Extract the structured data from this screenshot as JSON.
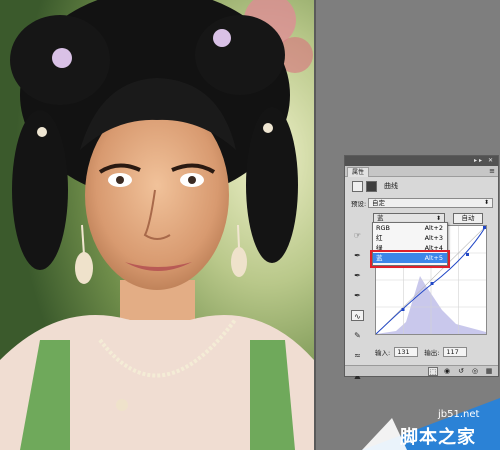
{
  "panel": {
    "title": "属性",
    "tab_label": "",
    "adjustment_name": "曲线",
    "preset_label": "预设:",
    "preset_value": "自定",
    "channel_value": "蓝",
    "auto_label": "自动",
    "input_label": "输入:",
    "input_value": "131",
    "output_label": "输出:",
    "output_value": "117"
  },
  "channel_menu": [
    {
      "label": "RGB",
      "shortcut": "Alt+2"
    },
    {
      "label": "红",
      "shortcut": "Alt+3"
    },
    {
      "label": "绿",
      "shortcut": "Alt+4"
    },
    {
      "label": "蓝",
      "shortcut": "Alt+5"
    }
  ],
  "watermark": {
    "site": "jb51.net",
    "text": "脚本之家"
  },
  "colors": {
    "highlight": "#e0202a",
    "selection": "#3d86e8"
  }
}
